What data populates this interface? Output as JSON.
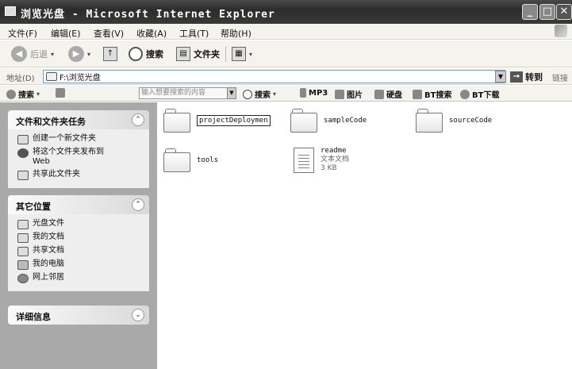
{
  "window": {
    "title": "浏览光盘 - Microsoft Internet Explorer",
    "buttons": {
      "minimize": "_",
      "maximize": "□",
      "close": "✕"
    }
  },
  "menubar": {
    "items": [
      "文件(F)",
      "编辑(E)",
      "查看(V)",
      "收藏(A)",
      "工具(T)",
      "帮助(H)"
    ]
  },
  "toolbar": {
    "back_label": "后退",
    "search_label": "搜索",
    "folders_label": "文件夹"
  },
  "address": {
    "label": "地址(D)",
    "value": "F:\\浏览光盘",
    "go_label": "转到",
    "links_label": "链接"
  },
  "searchbar": {
    "search_label": "搜索",
    "input_placeholder": "输入想要搜索的内容",
    "items": [
      "搜索",
      "MP3",
      "图片",
      "硬盘",
      "BT搜索",
      "BT下载"
    ]
  },
  "taskpane": {
    "file_tasks": {
      "title": "文件和文件夹任务",
      "items": [
        "创建一个新文件夹",
        "将这个文件夹发布到 Web",
        "共享此文件夹"
      ]
    },
    "other_places": {
      "title": "其它位置",
      "items": [
        "光盘文件",
        "我的文档",
        "共享文档",
        "我的电脑",
        "网上邻居"
      ]
    },
    "details": {
      "title": "详细信息"
    }
  },
  "content": {
    "folders": [
      "projectDeploymen",
      "sampleCode",
      "sourceCode",
      "tools"
    ],
    "file": {
      "name": "readme",
      "type": "文本文档",
      "size": "3 KB"
    }
  },
  "colors": {
    "titlebar": "#3a3a3a",
    "taskpane_bg": "#a9a9a9",
    "panel_bg": "#eeeeee",
    "chrome_bg": "#f4f3ee"
  }
}
